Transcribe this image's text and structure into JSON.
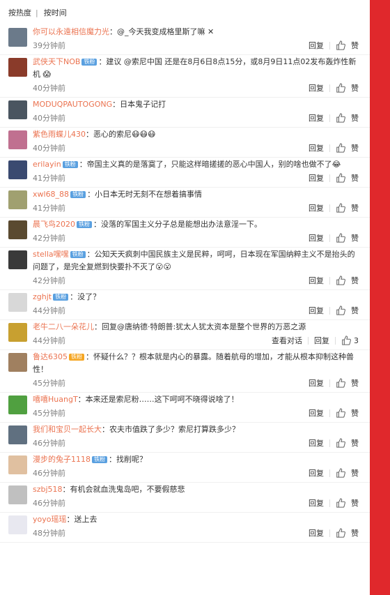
{
  "tabs": {
    "hot": "按热度",
    "sep": "|",
    "time": "按时间"
  },
  "ops": {
    "reply": "回复",
    "like_icon": "thumb-up-icon",
    "like_label": "赞",
    "view_conversation": "查看对话"
  },
  "colors": {
    "username": "#eb7350",
    "sidebar": "#e0282c",
    "badge": "#5aa0e0"
  },
  "comments": [
    {
      "user": "你可以永遠相信魔力光",
      "badge": "",
      "text": "：@_今天我变成格里斯了嘛 ✕",
      "time": "39分钟前",
      "likes": ""
    },
    {
      "user": "武侠天下NOB",
      "badge": "铁粉",
      "text": "：建议 @索尼中国 还是在8月6日8点15分，或8月9日11点02发布轰炸性新机 😱",
      "time": "40分钟前",
      "likes": ""
    },
    {
      "user": "MODUQPAUTOGONG",
      "badge": "",
      "text": "：日本鬼子记打",
      "time": "40分钟前",
      "likes": ""
    },
    {
      "user": "紫色雨蝶儿430",
      "badge": "",
      "text": "：恶心的索尼😷😷😷",
      "time": "40分钟前",
      "likes": ""
    },
    {
      "user": "erilayin",
      "badge": "铁粉",
      "text": "：帝国主义真的是落寞了，只能这样暗搓搓的恶心中国人，别的啥也做不了😂",
      "time": "41分钟前",
      "likes": ""
    },
    {
      "user": "xwl68_88",
      "badge": "铁粉",
      "text": "：小日本无时无刻不在想着搞事情",
      "time": "41分钟前",
      "likes": ""
    },
    {
      "user": "晨飞鸟2020",
      "badge": "铁粉",
      "text": "：没落的军国主义分子总是能想出办法意淫一下。",
      "time": "42分钟前",
      "likes": ""
    },
    {
      "user": "stella嘿嘿",
      "badge": "铁粉",
      "text": "：公知天天疯刺中国民族主义是民粹，呵呵，日本现在军国纳粹主义不是抬头的问题了，是完全复燃到快要扑不灭了😮😮",
      "time": "42分钟前",
      "likes": ""
    },
    {
      "user": "zghjt",
      "badge": "铁粉",
      "text": "：没了？",
      "time": "44分钟前",
      "likes": ""
    },
    {
      "user": "老牛二八一朵花儿",
      "badge": "",
      "text": "：回复@唐纳德·特朗普:犹太人犹太资本是整个世界的万恶之源",
      "time": "44分钟前",
      "likes": "3",
      "view": true
    },
    {
      "user": "鲁达6305",
      "badge": "铁粉",
      "text": "：怀疑什么？？根本就是内心的暴露。随着航母的增加，才能从根本抑制这种兽性！",
      "time": "45分钟前",
      "likes": ""
    },
    {
      "user": "嘻嘻HuangT",
      "badge": "",
      "text": "：本来还是索尼粉……这下呵呵不晓得说啥了！",
      "time": "45分钟前",
      "likes": ""
    },
    {
      "user": "我们和宝贝一起长大",
      "badge": "",
      "text": "：农夫市值跌了多少？索尼打算跌多少？",
      "time": "46分钟前",
      "likes": ""
    },
    {
      "user": "漫步的兔子1118",
      "badge": "铁粉",
      "text": "：找削呢？",
      "time": "46分钟前",
      "likes": ""
    },
    {
      "user": "szbj518",
      "badge": "",
      "text": "：有机会就血洗鬼岛吧，不要假慈悲",
      "time": "46分钟前",
      "likes": ""
    },
    {
      "user": "yoyo瑶瑶",
      "badge": "",
      "text": "：送上去",
      "time": "48分钟前",
      "likes": ""
    }
  ]
}
